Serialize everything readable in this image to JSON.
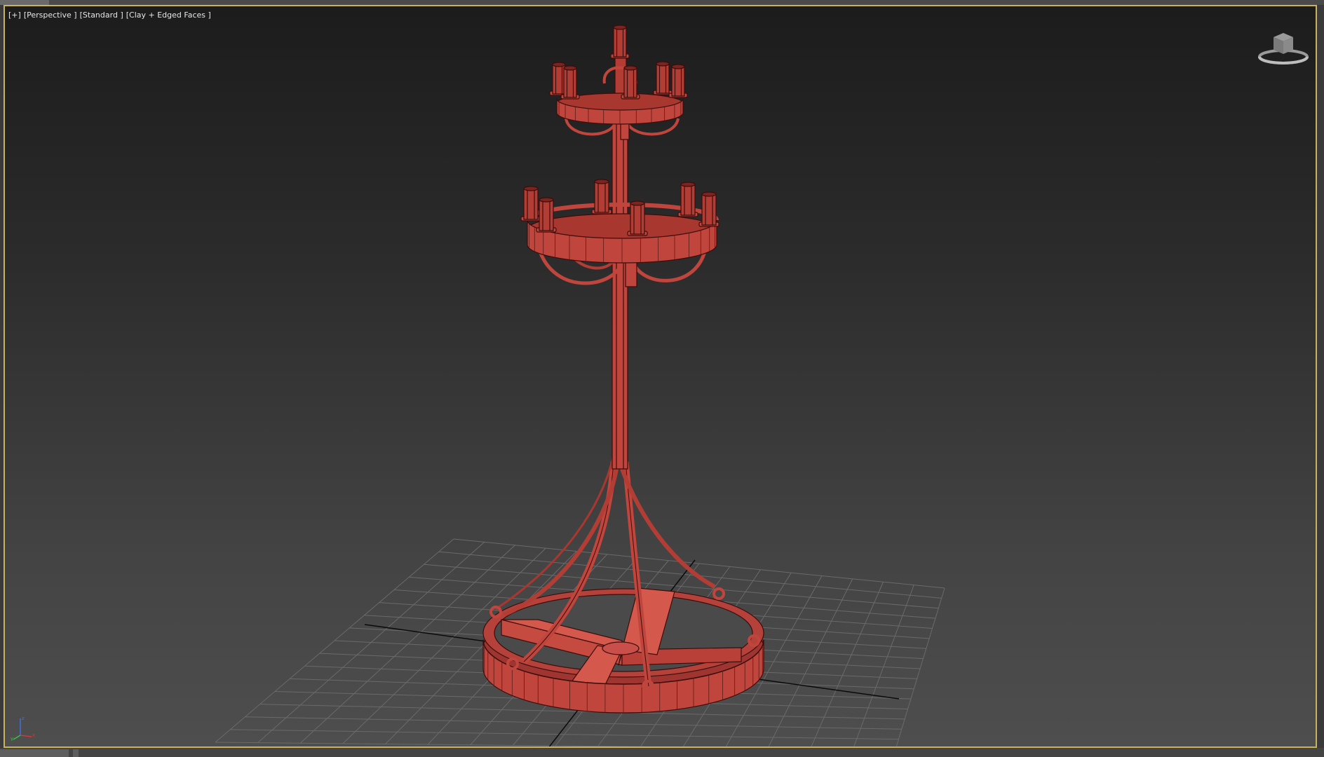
{
  "viewport": {
    "labels": {
      "plus": "[+]",
      "view": "[Perspective ]",
      "shading_preset": "[Standard ]",
      "display_mode": "[Clay + Edged Faces ]"
    }
  },
  "viewcube": {
    "icon": "viewcube-icon"
  },
  "axis_tripod": {
    "icon": "axis-tripod-icon",
    "x_color": "#d13a3a",
    "y_color": "#3fbf3f",
    "z_color": "#3f6fdf"
  },
  "colors": {
    "model": "#c0453c",
    "model_edges": "#3c0d0b",
    "grid": "#6c6c6c",
    "viewport_border": "#c9b25a"
  }
}
